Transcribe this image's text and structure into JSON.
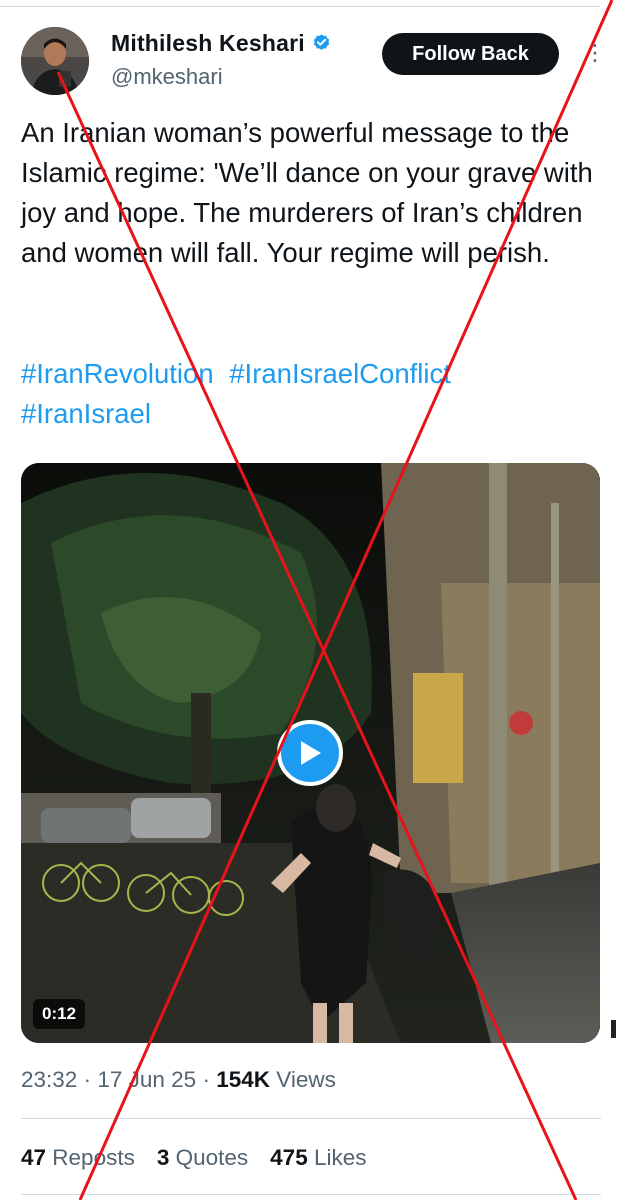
{
  "author": {
    "name": "Mithilesh Keshari",
    "handle": "@mkeshari",
    "verified": true,
    "follow_button": "Follow Back"
  },
  "tweet": {
    "text": "An Iranian woman’s powerful message to the Islamic regime: 'We’ll dance on your grave with joy and hope. The murderers of Iran’s children and women will fall. Your regime will perish.",
    "hashtags": [
      "#IranRevolution",
      "#IranIsraelConflict",
      "#IranIsrael"
    ]
  },
  "media": {
    "type": "video",
    "duration": "0:12"
  },
  "meta": {
    "time": "23:32",
    "date": "17 Jun 25",
    "views_count": "154K",
    "views_label": "Views",
    "separator": "·"
  },
  "stats": {
    "reposts_count": "47",
    "reposts_label": "Reposts",
    "quotes_count": "3",
    "quotes_label": "Quotes",
    "likes_count": "475",
    "likes_label": "Likes"
  },
  "colors": {
    "accent": "#1d9bf0",
    "text": "#0f1419",
    "secondary": "#536471",
    "cross": "#e8131a"
  }
}
